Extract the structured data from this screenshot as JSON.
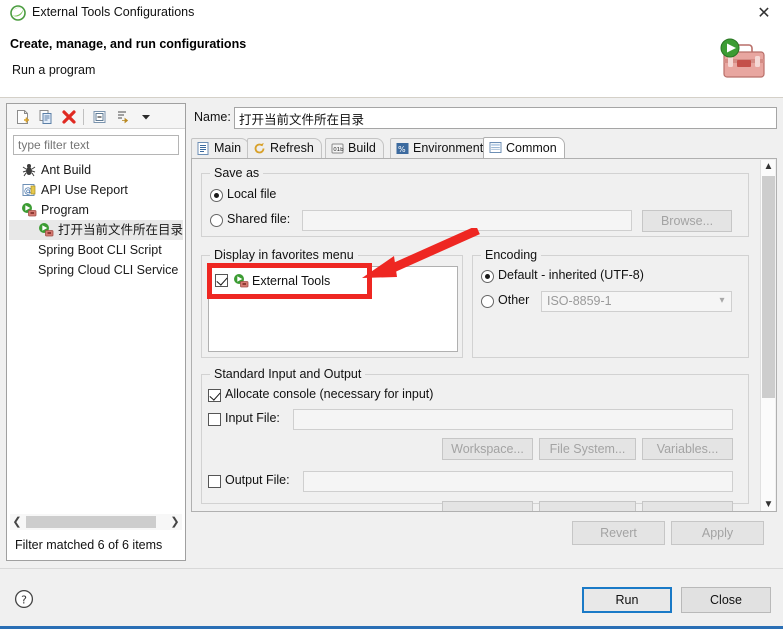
{
  "window": {
    "title": "External Tools Configurations",
    "icon": "eclipse-icon",
    "close_label": "✕"
  },
  "header": {
    "title": "Create, manage, and run configurations",
    "subtitle": "Run a program",
    "banner_icon": "external-tools-toolbox-icon"
  },
  "tree_toolbar": {
    "buttons": [
      {
        "name": "new-configuration-icon",
        "title": "New launch configuration"
      },
      {
        "name": "duplicate-configuration-icon",
        "title": "Duplicate"
      },
      {
        "name": "delete-configuration-icon",
        "title": "Delete"
      },
      {
        "name": "collapse-all-icon",
        "title": "Collapse All"
      },
      {
        "name": "filter-launch-icon",
        "title": "Filter"
      },
      {
        "name": "view-menu-chevron-icon",
        "title": "View Menu"
      }
    ]
  },
  "filter": {
    "placeholder": "type filter text",
    "value": "",
    "status": "Filter matched 6 of 6 items"
  },
  "tree": {
    "items": [
      {
        "label": "Ant Build",
        "icon": "ant-build-icon",
        "indent": 0,
        "selected": false
      },
      {
        "label": "API Use Report",
        "icon": "api-use-report-icon",
        "indent": 0,
        "selected": false
      },
      {
        "label": "Program",
        "icon": "program-icon",
        "indent": 0,
        "selected": false
      },
      {
        "label": "打开当前文件所在目录",
        "icon": "program-icon",
        "indent": 1,
        "selected": true
      },
      {
        "label": "Spring Boot CLI Script",
        "icon": "none",
        "indent": 1,
        "selected": false
      },
      {
        "label": "Spring Cloud CLI Service",
        "icon": "none",
        "indent": 1,
        "selected": false
      }
    ]
  },
  "name_field": {
    "label": "Name:",
    "value": "打开当前文件所在目录"
  },
  "tabs": [
    {
      "label": "Main",
      "icon": "main-tab-icon",
      "active": false
    },
    {
      "label": "Refresh",
      "icon": "refresh-tab-icon",
      "active": false
    },
    {
      "label": "Build",
      "icon": "build-tab-icon",
      "active": false
    },
    {
      "label": "Environment",
      "icon": "environment-tab-icon",
      "active": false
    },
    {
      "label": "Common",
      "icon": "common-tab-icon",
      "active": true
    }
  ],
  "common_tab": {
    "save_as": {
      "title": "Save as",
      "local_file": {
        "label": "Local file",
        "selected": true
      },
      "shared_file": {
        "label": "Shared file:",
        "selected": false,
        "value": "",
        "enabled": false
      },
      "browse_button": {
        "label": "Browse...",
        "enabled": false
      }
    },
    "favorites": {
      "title": "Display in favorites menu",
      "items": [
        {
          "label": "External Tools",
          "icon": "external-tools-icon",
          "checked": true
        }
      ]
    },
    "encoding": {
      "title": "Encoding",
      "default": {
        "label": "Default - inherited (UTF-8)",
        "selected": true
      },
      "other": {
        "label": "Other",
        "selected": false
      },
      "other_value": "ISO-8859-1",
      "other_enabled": false
    },
    "standard_io": {
      "title": "Standard Input and Output",
      "allocate_console": {
        "label": "Allocate console (necessary for input)",
        "checked": true
      },
      "input_file": {
        "label": "Input File:",
        "checked": false,
        "value": "",
        "enabled": false
      },
      "output_file": {
        "label": "Output File:",
        "checked": false,
        "value": "",
        "enabled": false
      },
      "buttons": [
        {
          "label": "Workspace...",
          "enabled": false
        },
        {
          "label": "File System...",
          "enabled": false
        },
        {
          "label": "Variables...",
          "enabled": false
        }
      ]
    }
  },
  "action_buttons": {
    "revert": {
      "label": "Revert",
      "enabled": false
    },
    "apply": {
      "label": "Apply",
      "enabled": false
    }
  },
  "footer": {
    "help_icon": "help-question-icon",
    "run": {
      "label": "Run",
      "focused": true
    },
    "close": {
      "label": "Close",
      "focused": false
    }
  },
  "annotations": {
    "highlight_color": "#ee2722",
    "rect_target": "favorites-list-external-tools",
    "arrow_target": "favorites-list-external-tools"
  }
}
